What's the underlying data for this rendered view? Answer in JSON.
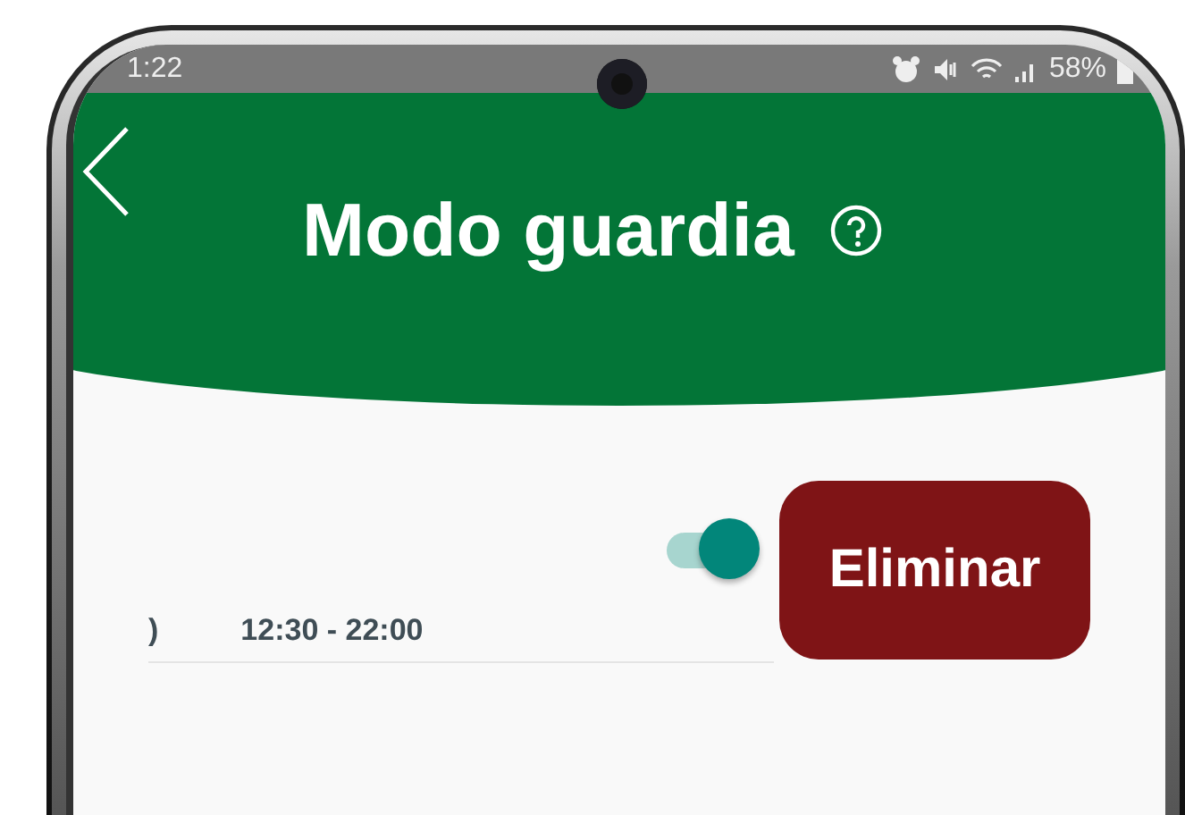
{
  "status_bar": {
    "time": "1:22",
    "battery": "58%"
  },
  "header": {
    "title": "Modo guardia"
  },
  "schedule": {
    "day": ")",
    "hours": "12:30 - 22:00",
    "enabled": true
  },
  "delete_button": {
    "label": "Eliminar"
  }
}
